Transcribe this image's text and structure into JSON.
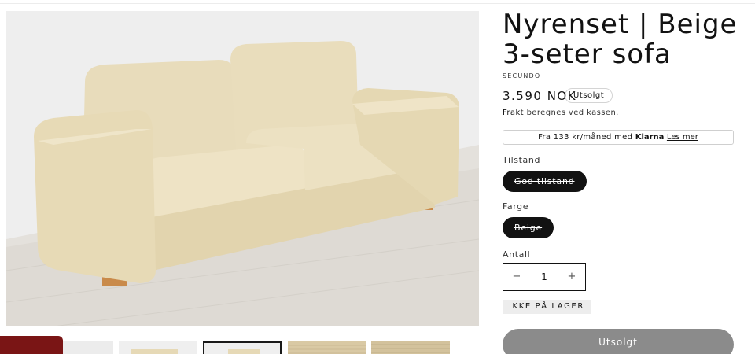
{
  "product": {
    "title": "Nyrenset | Beige 3-seter sofa",
    "vendor": "SECUNDO",
    "price": "3.590 NOK",
    "sold_badge": "Utsolgt",
    "shipping_link": "Frakt",
    "shipping_text": " beregnes ved kassen."
  },
  "klarna": {
    "prefix": "Fra 133 kr/måned med ",
    "logo": "Klarna",
    "link": "Les mer"
  },
  "options": {
    "condition_label": "Tilstand",
    "condition_value": "God tilstand",
    "color_label": "Farge",
    "color_value": "Beige"
  },
  "quantity": {
    "label": "Antall",
    "value": "1",
    "minus": "−",
    "plus": "+"
  },
  "stock_status": "IKKE PÅ LAGER",
  "submit_label": "Utsolgt",
  "gallery": {
    "thumbnails": 5,
    "active_index": 2
  },
  "colors": {
    "text": "#121212",
    "pill": "#121212",
    "sold_button": "#8b8b8b",
    "stock_badge": "#ededed",
    "promo_tab": "#7a1515",
    "sofa": "#e6d9b6"
  }
}
